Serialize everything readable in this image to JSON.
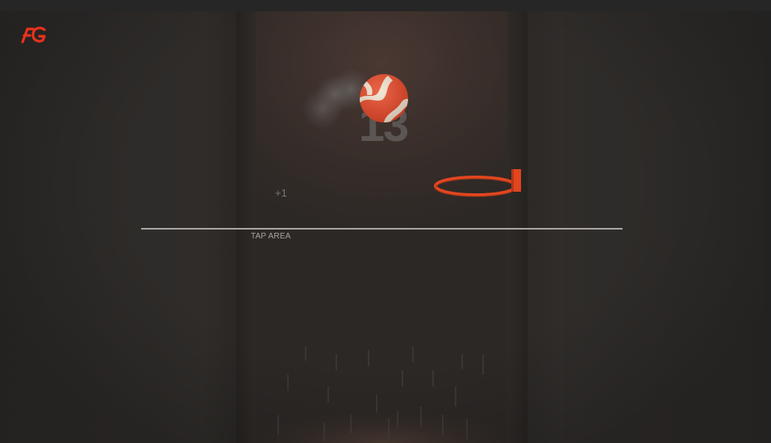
{
  "game": {
    "score": "13",
    "score_popup": "+1",
    "tap_area_label": "TAP AREA"
  },
  "logo": {
    "name": "fg-logo-icon",
    "color": "#e8321c"
  },
  "colors": {
    "ball_primary": "#e84a2a",
    "ball_stripe": "#f3e3cf",
    "hoop": "#e2461f",
    "tap_line": "#a8a5a3",
    "score_text": "#5b5553"
  },
  "icons": {
    "ball": "basketball-icon",
    "hoop": "hoop-icon",
    "logo": "fg-logo-icon"
  }
}
